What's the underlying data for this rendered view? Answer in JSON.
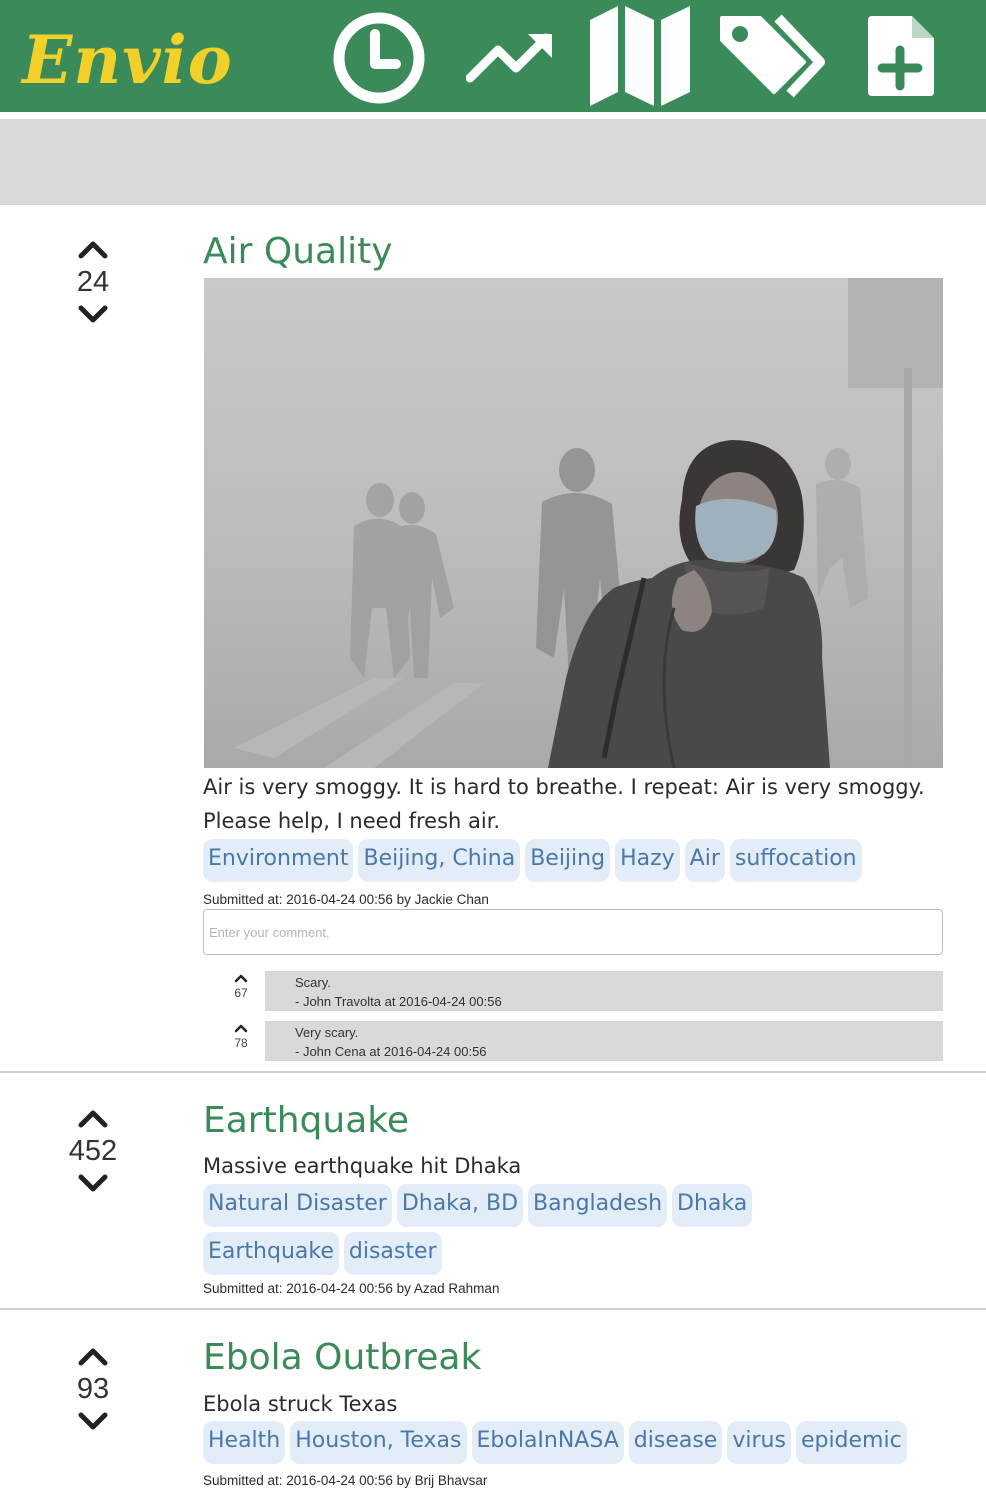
{
  "header": {
    "logo": "Envio",
    "icons": [
      "clock-icon",
      "trending-up-icon",
      "map-icon",
      "tags-icon",
      "new-file-icon"
    ],
    "colors": {
      "bar": "#3a8b59",
      "logo": "#f1d02a",
      "icon": "#ffffff"
    }
  },
  "posts": [
    {
      "title": "Air Quality",
      "votes": "24",
      "description": "Air is very smoggy. It is hard to breathe. I repeat: Air is very smoggy. Please help, I need fresh air.",
      "tags": [
        "Environment",
        "Beijing, China",
        "Beijing",
        "Hazy",
        "Air",
        "suffocation"
      ],
      "submitted": "Submitted at: 2016-04-24 00:56 by Jackie Chan",
      "comment_placeholder": "Enter your comment.",
      "comments": [
        {
          "votes": "67",
          "text": "Scary.",
          "meta": "- John Travolta at 2016-04-24 00:56"
        },
        {
          "votes": "78",
          "text": "Very scary.",
          "meta": "- John Cena at 2016-04-24 00:56"
        }
      ]
    },
    {
      "title": "Earthquake",
      "votes": "452",
      "description": "Massive earthquake hit Dhaka",
      "tags": [
        "Natural Disaster",
        "Dhaka, BD",
        "Bangladesh",
        "Dhaka",
        "Earthquake",
        "disaster"
      ],
      "submitted": "Submitted at: 2016-04-24 00:56 by Azad Rahman"
    },
    {
      "title": "Ebola Outbreak",
      "votes": "93",
      "description": "Ebola struck Texas",
      "tags": [
        "Health",
        "Houston, Texas",
        "EbolaInNASA",
        "disease",
        "virus",
        "epidemic"
      ],
      "submitted": "Submitted at: 2016-04-24 00:56 by Brij Bhavsar"
    }
  ],
  "colors": {
    "title": "#3a8b59",
    "tag_bg": "#e3edf8",
    "tag_text": "#4a78a8"
  }
}
